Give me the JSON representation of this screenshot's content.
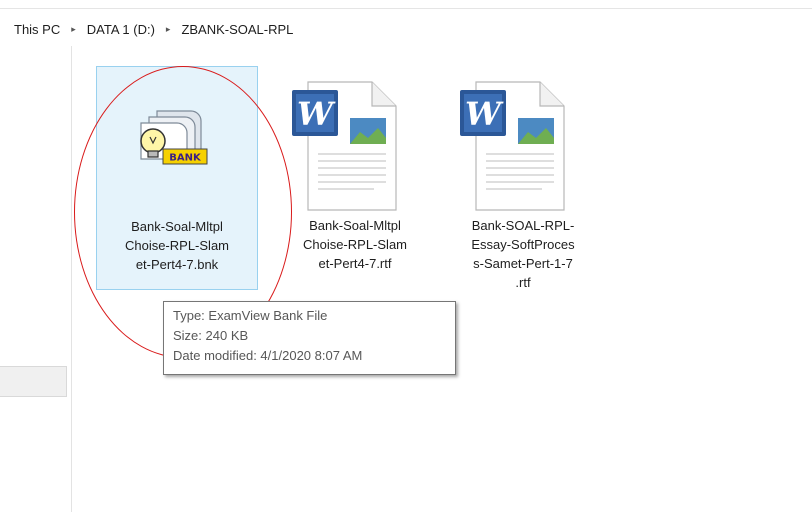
{
  "breadcrumb": {
    "items": [
      "This PC",
      "DATA 1 (D:)",
      "ZBANK-SOAL-RPL"
    ],
    "separator": "▸"
  },
  "files": [
    {
      "name_lines": [
        "Bank-Soal-Mltpl",
        "Choise-RPL-Slam",
        "et-Pert4-7.bnk"
      ],
      "icon": "examview-bank-icon",
      "selected": true
    },
    {
      "name_lines": [
        "Bank-Soal-Mltpl",
        "Choise-RPL-Slam",
        "et-Pert4-7.rtf"
      ],
      "icon": "word-document-icon",
      "selected": false
    },
    {
      "name_lines": [
        "Bank-SOAL-RPL-",
        "Essay-SoftProces",
        "s-Samet-Pert-1-7",
        ".rtf"
      ],
      "icon": "word-document-icon",
      "selected": false
    }
  ],
  "tooltip": {
    "type": "Type: ExamView Bank File",
    "size": "Size: 240 KB",
    "modified": "Date modified: 4/1/2020 8:07 AM"
  },
  "annotation": {
    "color": "#d91b1b"
  },
  "colors": {
    "selection_bg": "#e5f3fb",
    "selection_border": "#99d1ef",
    "word_blue": "#2b5797"
  }
}
